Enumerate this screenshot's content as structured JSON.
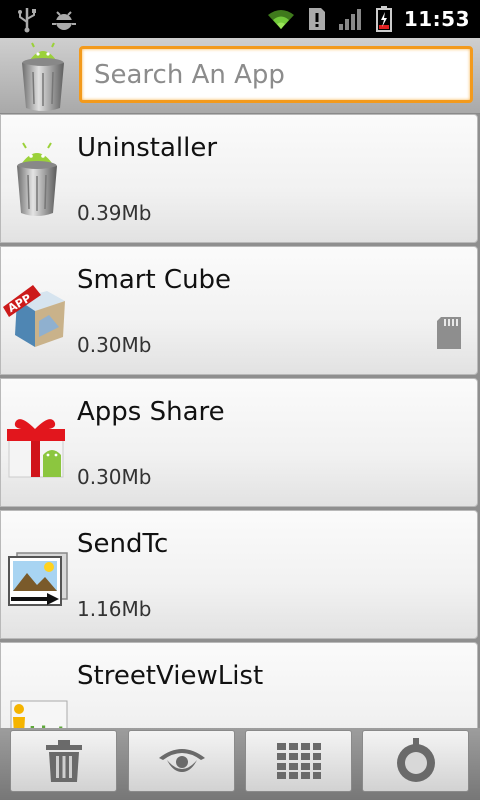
{
  "status_bar": {
    "time": "11:53",
    "icons": [
      "usb-icon",
      "android-debug-icon",
      "wifi-icon",
      "alert-icon",
      "signal-icon",
      "battery-charging-icon"
    ]
  },
  "header": {
    "logo": "trash-can-android-icon",
    "search_placeholder": "Search An App",
    "search_value": ""
  },
  "apps": [
    {
      "name": "Uninstaller",
      "size": "0.39Mb",
      "icon": "uninstaller-icon",
      "on_sd": false
    },
    {
      "name": "Smart Cube",
      "size": "0.30Mb",
      "icon": "smart-cube-icon",
      "on_sd": true
    },
    {
      "name": "Apps Share",
      "size": "0.30Mb",
      "icon": "apps-share-icon",
      "on_sd": false
    },
    {
      "name": "SendTc",
      "size": "1.16Mb",
      "icon": "sendtc-icon",
      "on_sd": false
    },
    {
      "name": "StreetViewList",
      "size": "",
      "icon": "streetviewlist-icon",
      "on_sd": false
    }
  ],
  "toolbar": {
    "buttons": [
      "trash-icon",
      "eye-icon",
      "grid-icon",
      "settings-ring-icon"
    ]
  },
  "colors": {
    "search_border": "#f39a1c",
    "header_bg": "#bdbdbd",
    "status_bar_bg": "#000000"
  }
}
